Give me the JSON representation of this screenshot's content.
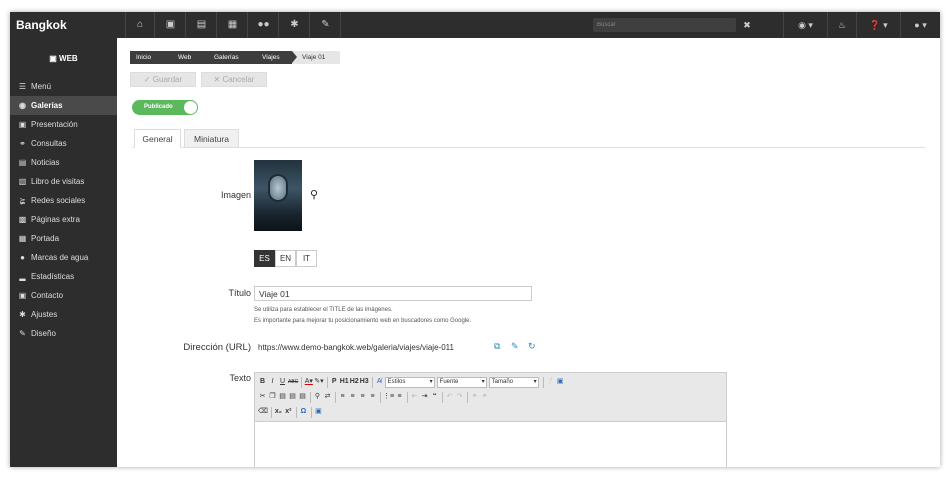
{
  "app": {
    "brand": "Bangkok"
  },
  "topbar": {
    "icons": [
      "home-icon",
      "desktop-icon",
      "file-icon",
      "store-icon",
      "users-icon",
      "gear-icon",
      "brush-icon"
    ],
    "search_placeholder": "Buscar",
    "right_icons": [
      "wrench-icon",
      "eye-icon",
      "bell-icon",
      "question-icon",
      "user-icon"
    ]
  },
  "sidebar": {
    "title": "WEB",
    "items": [
      {
        "label": "Menú",
        "icon": "menu-icon"
      },
      {
        "label": "Galerías",
        "icon": "camera-icon",
        "active": true
      },
      {
        "label": "Presentación",
        "icon": "image-icon"
      },
      {
        "label": "Consultas",
        "icon": "comments-icon"
      },
      {
        "label": "Noticias",
        "icon": "newspaper-icon"
      },
      {
        "label": "Libro de visitas",
        "icon": "book-icon"
      },
      {
        "label": "Redes sociales",
        "icon": "share-icon"
      },
      {
        "label": "Páginas extra",
        "icon": "file-icon"
      },
      {
        "label": "Portada",
        "icon": "grid-icon"
      },
      {
        "label": "Marcas de agua",
        "icon": "droplet-icon"
      },
      {
        "label": "Estadísticas",
        "icon": "chart-icon"
      },
      {
        "label": "Contacto",
        "icon": "contact-card-icon"
      },
      {
        "label": "Ajustes",
        "icon": "cog-icon"
      },
      {
        "label": "Diseño",
        "icon": "brush-icon"
      }
    ]
  },
  "breadcrumb": [
    "Inicio",
    "Web",
    "Galerías",
    "Viajes",
    "Viaje 01"
  ],
  "actions": {
    "save": "Guardar",
    "cancel": "Cancelar"
  },
  "status_toggle": {
    "label": "Publicado",
    "on": true
  },
  "tabs": [
    {
      "label": "General",
      "active": true
    },
    {
      "label": "Miniatura"
    }
  ],
  "form": {
    "image_label": "Imagen",
    "languages": [
      "ES",
      "EN",
      "IT"
    ],
    "active_language": "ES",
    "title_label": "Título",
    "title_value": "Viaje 01",
    "title_help_1": "Se utiliza para establecer el TITLE de las imágenes.",
    "title_help_2": "Es importante para mejorar tu posicionamiento web en buscadores como Google.",
    "url_label": "Dirección (URL)",
    "url_value": "https://www.demo-bangkok.web/galeria/viajes/viaje-011",
    "text_label": "Texto"
  },
  "editor": {
    "styles": "Estilos",
    "font": "Fuente",
    "size": "Tamaño"
  },
  "colors": {
    "toggle": "#5cb85c",
    "link_icons": "#2a8ac2",
    "dark": "#2d2d2d"
  }
}
